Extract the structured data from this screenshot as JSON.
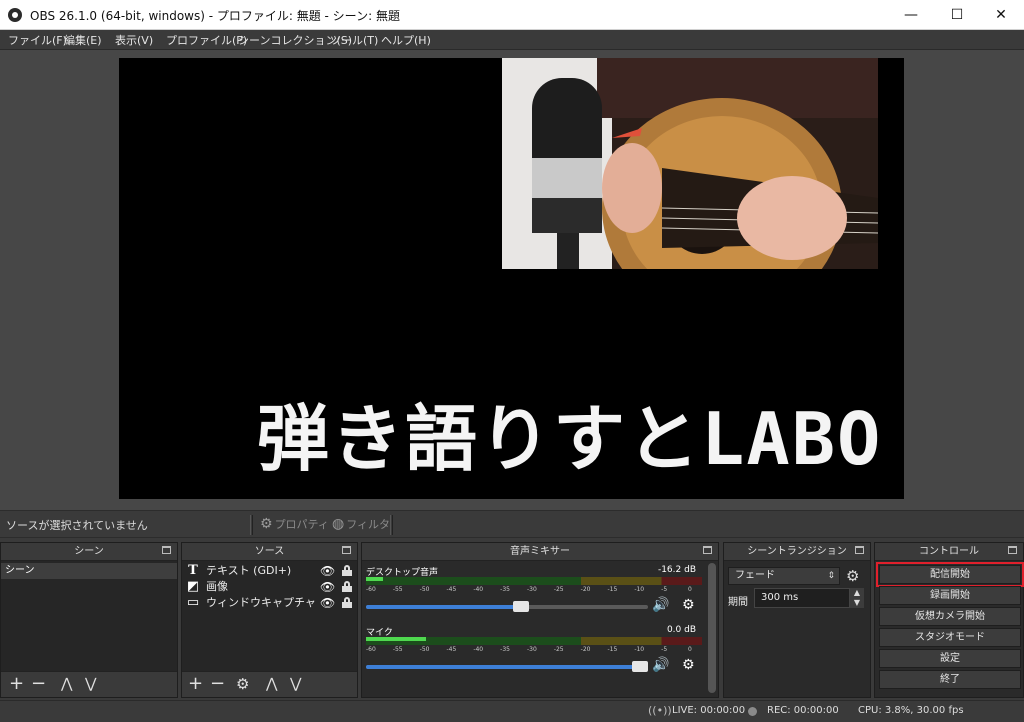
{
  "window": {
    "title": "OBS 26.1.0 (64-bit, windows) - プロファイル: 無題 - シーン: 無題",
    "minimize": "—",
    "maximize": "☐",
    "close": "✕"
  },
  "menu": [
    "ファイル(F)",
    "編集(E)",
    "表示(V)",
    "プロファイル(P)",
    "シーンコレクション(S)",
    "ツール(T)",
    "ヘルプ(H)"
  ],
  "preview": {
    "overlay_text": "弾き語りすとLABO"
  },
  "source_toolbar": {
    "status": "ソースが選択されていません",
    "properties": "プロパティ",
    "filters": "フィルタ"
  },
  "scenes": {
    "header": "シーン",
    "items": [
      "シーン"
    ]
  },
  "sources": {
    "header": "ソース",
    "items": [
      {
        "label": "テキスト (GDI+)",
        "icon": "T"
      },
      {
        "label": "画像",
        "icon": "◩"
      },
      {
        "label": "ウィンドウキャプチャ",
        "icon": "▭"
      }
    ]
  },
  "mixer": {
    "header": "音声ミキサー",
    "channels": [
      {
        "name": "デスクトップ音声",
        "db": "-16.2 dB",
        "level": 0.05,
        "volume": 0.55
      },
      {
        "name": "マイク",
        "db": "0.0 dB",
        "level": 0.18,
        "volume": 0.97
      }
    ],
    "ticks": [
      "-60",
      "-55",
      "-50",
      "-45",
      "-40",
      "-35",
      "-30",
      "-25",
      "-20",
      "-15",
      "-10",
      "-5",
      "0"
    ]
  },
  "transitions": {
    "header": "シーントランジション",
    "selected": "フェード",
    "duration_label": "期間",
    "duration_value": "300 ms"
  },
  "controls": {
    "header": "コントロール",
    "buttons": [
      "配信開始",
      "録画開始",
      "仮想カメラ開始",
      "スタジオモード",
      "設定",
      "終了"
    ]
  },
  "status": {
    "live": "LIVE: 00:00:00",
    "rec": "REC: 00:00:00",
    "cpu": "CPU: 3.8%, 30.00 fps"
  },
  "colors": {
    "highlight": "#e0202c",
    "fader_fill": "#3d7fd6",
    "meter_green": "#4fd94f"
  }
}
